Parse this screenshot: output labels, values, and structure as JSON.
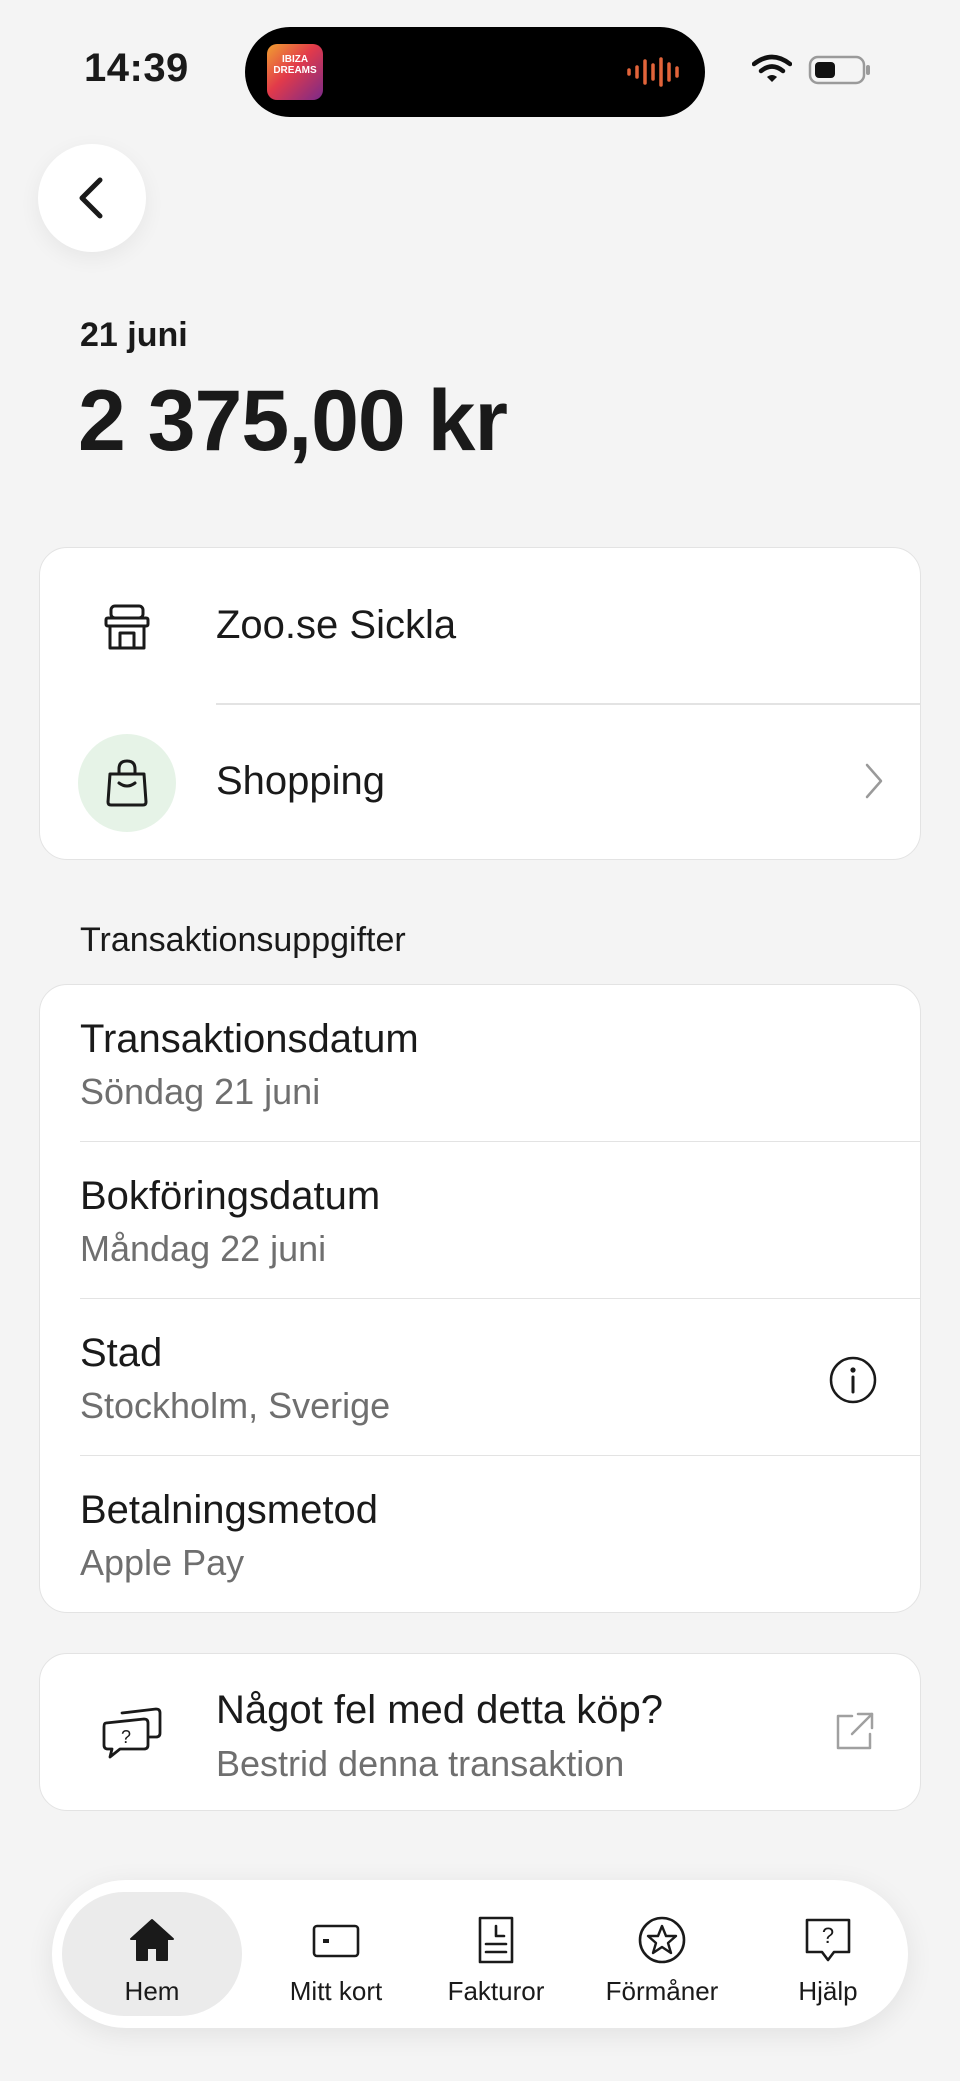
{
  "status_bar": {
    "time": "14:39",
    "now_playing_art_text": "IBIZA DREAMS"
  },
  "transaction": {
    "date": "21 juni",
    "amount": "2 375,00 kr"
  },
  "merchant": {
    "name": "Zoo.se Sickla",
    "category": "Shopping"
  },
  "details": {
    "section_title": "Transaktionsuppgifter",
    "rows": [
      {
        "label": "Transaktionsdatum",
        "value": "Söndag 21 juni"
      },
      {
        "label": "Bokföringsdatum",
        "value": "Måndag 22 juni"
      },
      {
        "label": "Stad",
        "value": "Stockholm, Sverige"
      },
      {
        "label": "Betalningsmetod",
        "value": "Apple Pay"
      }
    ]
  },
  "dispute": {
    "title": "Något fel med detta köp?",
    "subtitle": "Bestrid denna transaktion"
  },
  "tabs": [
    {
      "label": "Hem",
      "icon": "home-icon",
      "active": true
    },
    {
      "label": "Mitt kort",
      "icon": "card-icon"
    },
    {
      "label": "Fakturor",
      "icon": "invoice-icon"
    },
    {
      "label": "Förmåner",
      "icon": "star-icon"
    },
    {
      "label": "Hjälp",
      "icon": "help-icon"
    }
  ],
  "colors": {
    "background": "#f4f4f4",
    "category_icon_bg": "#e6f3e7",
    "secondary_text": "#6f6f6f",
    "wave_accent": "#e2643a"
  }
}
